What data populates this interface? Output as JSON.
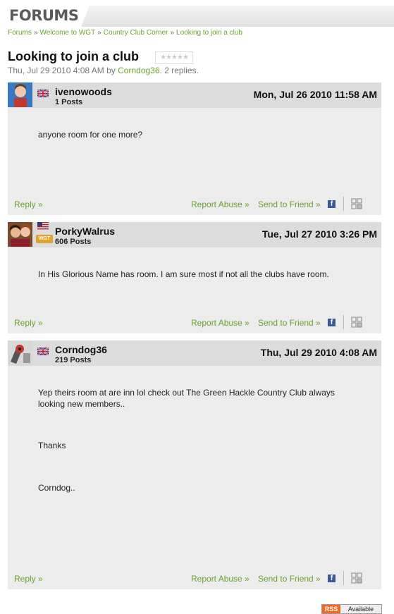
{
  "header": {
    "title": "FORUMS"
  },
  "breadcrumb": [
    {
      "label": "Forums"
    },
    {
      "label": "Welcome to WGT"
    },
    {
      "label": "Country Club Corner"
    },
    {
      "label": "Looking to join a club"
    }
  ],
  "breadcrumb_sep": "»",
  "thread": {
    "title": "Looking to join a club",
    "rating_stars": "★★★★★",
    "meta_date": "Thu, Jul 29 2010 4:08 AM",
    "meta_by": "by",
    "meta_author": "Corndog36",
    "meta_replies": ". 2 replies."
  },
  "actions": {
    "reply": "Reply »",
    "report": "Report Abuse »",
    "send": "Send to Friend »",
    "fb": "f"
  },
  "posts": [
    {
      "username": "ivenowoods",
      "posts": "1 Posts",
      "date": "Mon, Jul 26 2010 11:58 AM",
      "body": [
        "anyone room for one more?"
      ]
    },
    {
      "username": "PorkyWalrus",
      "posts": "606 Posts",
      "date": "Tue, Jul 27 2010 3:26 PM",
      "badge": "WGT",
      "body": [
        "In His Glorious Name has room. I am sure most if not all the clubs have room."
      ]
    },
    {
      "username": "Corndog36",
      "posts": "219 Posts",
      "date": "Thu, Jul 29 2010 4:08 AM",
      "body": [
        "Yep theirs room at are inn lol check out The Green Hackle Country Club always looking new members..",
        "Thanks",
        "Corndog.."
      ]
    }
  ],
  "rss": {
    "label": "RSS",
    "status": "Available"
  }
}
